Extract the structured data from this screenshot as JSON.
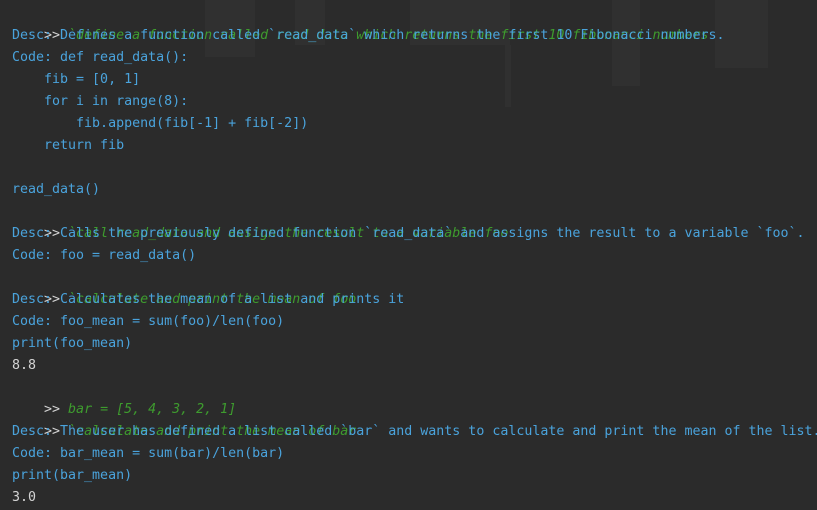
{
  "theme": {
    "background": "#2b2b2b",
    "prompt_color": "#d4d4d4",
    "command_color": "#3e9c2e",
    "info_color": "#4aa3dc",
    "output_color": "#d4d4d4"
  },
  "lines": [
    {
      "prompt": ">>",
      "text": " `define a function called read_data which returns the first 10 fibonacci numbers"
    },
    {
      "text": "Desc: Defines a function called `read_data` which returns the first 10 Fibonacci numbers."
    },
    {
      "text": "Code: def read_data():"
    },
    {
      "text": "    fib = [0, 1]"
    },
    {
      "text": "    for i in range(8):"
    },
    {
      "text": "        fib.append(fib[-1] + fib[-2])"
    },
    {
      "text": "    return fib"
    },
    {
      "text": ""
    },
    {
      "text": "read_data()"
    },
    {
      "prompt": ">>",
      "text": " `call read_data and assign the result to a variable foo"
    },
    {
      "text": "Desc: Calls the previously defined function `read_data` and assigns the result to a variable `foo`."
    },
    {
      "text": "Code: foo = read_data()"
    },
    {
      "prompt": ">>",
      "text": " `calculate and print the mean of foo"
    },
    {
      "text": "Desc: Calculates the mean of a list and prints it"
    },
    {
      "text": "Code: foo_mean = sum(foo)/len(foo)"
    },
    {
      "text": "print(foo_mean)"
    },
    {
      "text": "8.8"
    },
    {
      "prompt": ">>",
      "text": " bar = [5, 4, 3, 2, 1]"
    },
    {
      "prompt": ">>",
      "text": " `calculate and print the mean of bar"
    },
    {
      "text": "Desc: The user has defined a list called `bar` and wants to calculate and print the mean of the list."
    },
    {
      "text": "Code: bar_mean = sum(bar)/len(bar)"
    },
    {
      "text": "print(bar_mean)"
    },
    {
      "text": "3.0"
    }
  ]
}
